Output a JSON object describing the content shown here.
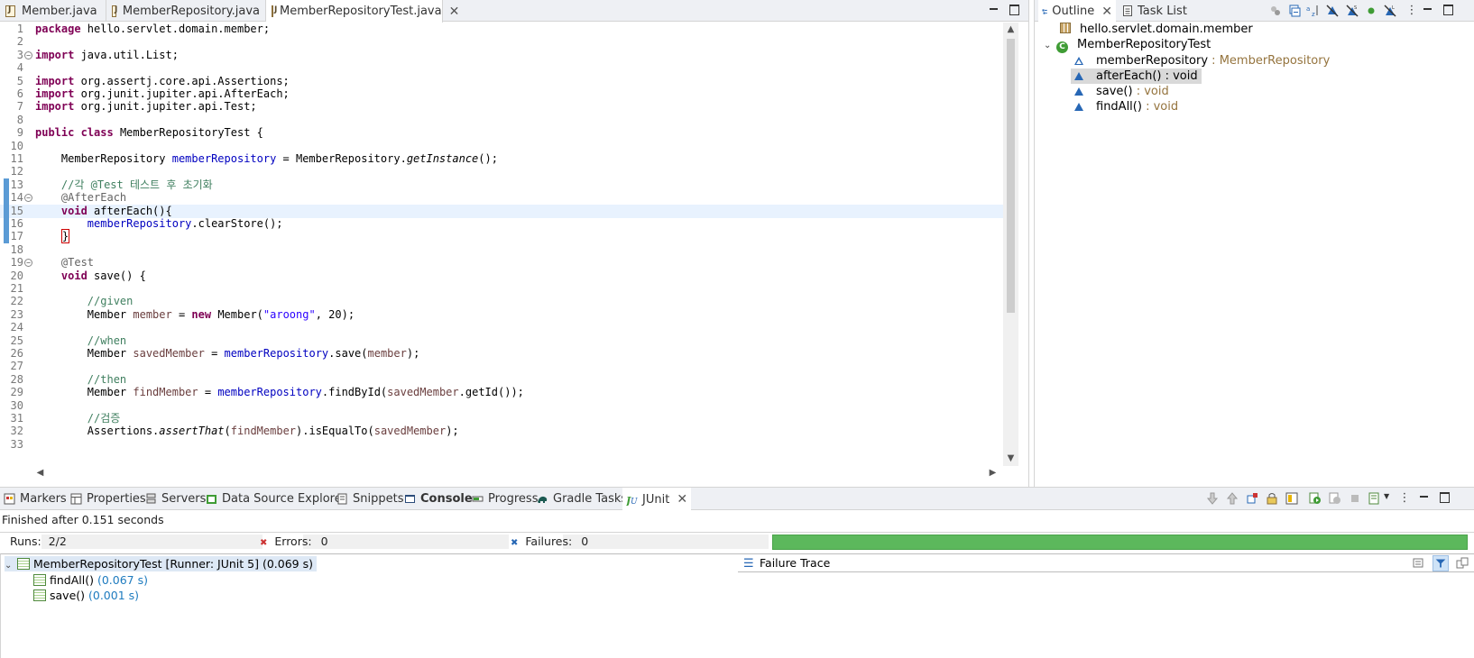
{
  "editor": {
    "tabs": [
      {
        "label": "Member.java"
      },
      {
        "label": "MemberRepository.java"
      },
      {
        "label": "MemberRepositoryTest.java"
      }
    ],
    "lines": [
      {
        "n": "1",
        "code": "<span class=\"kw\">package</span> hello.servlet.domain.member;"
      },
      {
        "n": "2",
        "code": ""
      },
      {
        "n": "3",
        "code": "<span class=\"kw\">import</span> java.util.List;"
      },
      {
        "n": "4",
        "code": ""
      },
      {
        "n": "5",
        "code": "<span class=\"kw\">import</span> org.assertj.core.api.Assertions;"
      },
      {
        "n": "6",
        "code": "<span class=\"kw\">import</span> org.junit.jupiter.api.AfterEach;"
      },
      {
        "n": "7",
        "code": "<span class=\"kw\">import</span> org.junit.jupiter.api.Test;"
      },
      {
        "n": "8",
        "code": ""
      },
      {
        "n": "9",
        "code": "<span class=\"kw\">public</span> <span class=\"kw\">class</span> MemberRepositoryTest {"
      },
      {
        "n": "10",
        "code": ""
      },
      {
        "n": "11",
        "code": "    MemberRepository <span class=\"fld\">memberRepository</span> = MemberRepository.<span class=\"it\">getInstance</span>();"
      },
      {
        "n": "12",
        "code": ""
      },
      {
        "n": "13",
        "code": "    <span class=\"cm\">//각 @Test 테스트 후 초기화</span>"
      },
      {
        "n": "14",
        "code": "    <span class=\"an\">@AfterEach</span>"
      },
      {
        "n": "15",
        "code": "    <span class=\"kw\">void</span> afterEach(){"
      },
      {
        "n": "16",
        "code": "        <span class=\"fld\">memberRepository</span>.clearStore();"
      },
      {
        "n": "17",
        "code": "    <span class=\"caret\">}</span>"
      },
      {
        "n": "18",
        "code": ""
      },
      {
        "n": "19",
        "code": "    <span class=\"an\">@Test</span>"
      },
      {
        "n": "20",
        "code": "    <span class=\"kw\">void</span> save() {"
      },
      {
        "n": "21",
        "code": ""
      },
      {
        "n": "22",
        "code": "        <span class=\"cm\">//given</span>"
      },
      {
        "n": "23",
        "code": "        Member <span class=\"loc\">member</span> = <span class=\"kw\">new</span> Member(<span class=\"str\">\"aroong\"</span>, 20);"
      },
      {
        "n": "24",
        "code": ""
      },
      {
        "n": "25",
        "code": "        <span class=\"cm\">//when</span>"
      },
      {
        "n": "26",
        "code": "        Member <span class=\"loc\">savedMember</span> = <span class=\"fld\">memberRepository</span>.save(<span class=\"loc\">member</span>);"
      },
      {
        "n": "27",
        "code": ""
      },
      {
        "n": "28",
        "code": "        <span class=\"cm\">//then</span>"
      },
      {
        "n": "29",
        "code": "        Member <span class=\"loc\">findMember</span> = <span class=\"fld\">memberRepository</span>.findById(<span class=\"loc\">savedMember</span>.getId());"
      },
      {
        "n": "30",
        "code": ""
      },
      {
        "n": "31",
        "code": "        <span class=\"cm\">//검증</span>"
      },
      {
        "n": "32",
        "code": "        Assertions.<span class=\"it\">assertThat</span>(<span class=\"loc\">findMember</span>).isEqualTo(<span class=\"loc\">savedMember</span>);"
      },
      {
        "n": "33",
        "code": ""
      }
    ]
  },
  "outline": {
    "tab_outline": "Outline",
    "tab_tasks": "Task List",
    "package": "hello.servlet.domain.member",
    "class_name": "MemberRepositoryTest",
    "members": [
      {
        "name": "memberRepository",
        "type": " : MemberRepository"
      },
      {
        "name": "afterEach()",
        "type": " : void"
      },
      {
        "name": "save()",
        "type": " : void"
      },
      {
        "name": "findAll()",
        "type": " : void"
      }
    ]
  },
  "bottom": {
    "tabs": [
      "Markers",
      "Properties",
      "Servers",
      "Data Source Explorer",
      "Snippets",
      "Console",
      "Progress",
      "Gradle Tasks",
      "JUnit"
    ],
    "status": "Finished after 0.151 seconds",
    "runs_label": "Runs:",
    "runs_value": "2/2",
    "errors_label": "Errors:",
    "errors_value": "0",
    "failures_label": "Failures:",
    "failures_value": "0",
    "progress_fraction": 1.0,
    "progress_color": "#5cb85c",
    "tree_root": "MemberRepositoryTest [Runner: JUnit 5] (0.069 s)",
    "tests": [
      {
        "name": "findAll()",
        "time": "(0.067 s)"
      },
      {
        "name": "save()",
        "time": "(0.001 s)"
      }
    ],
    "failure_trace": "Failure Trace"
  }
}
